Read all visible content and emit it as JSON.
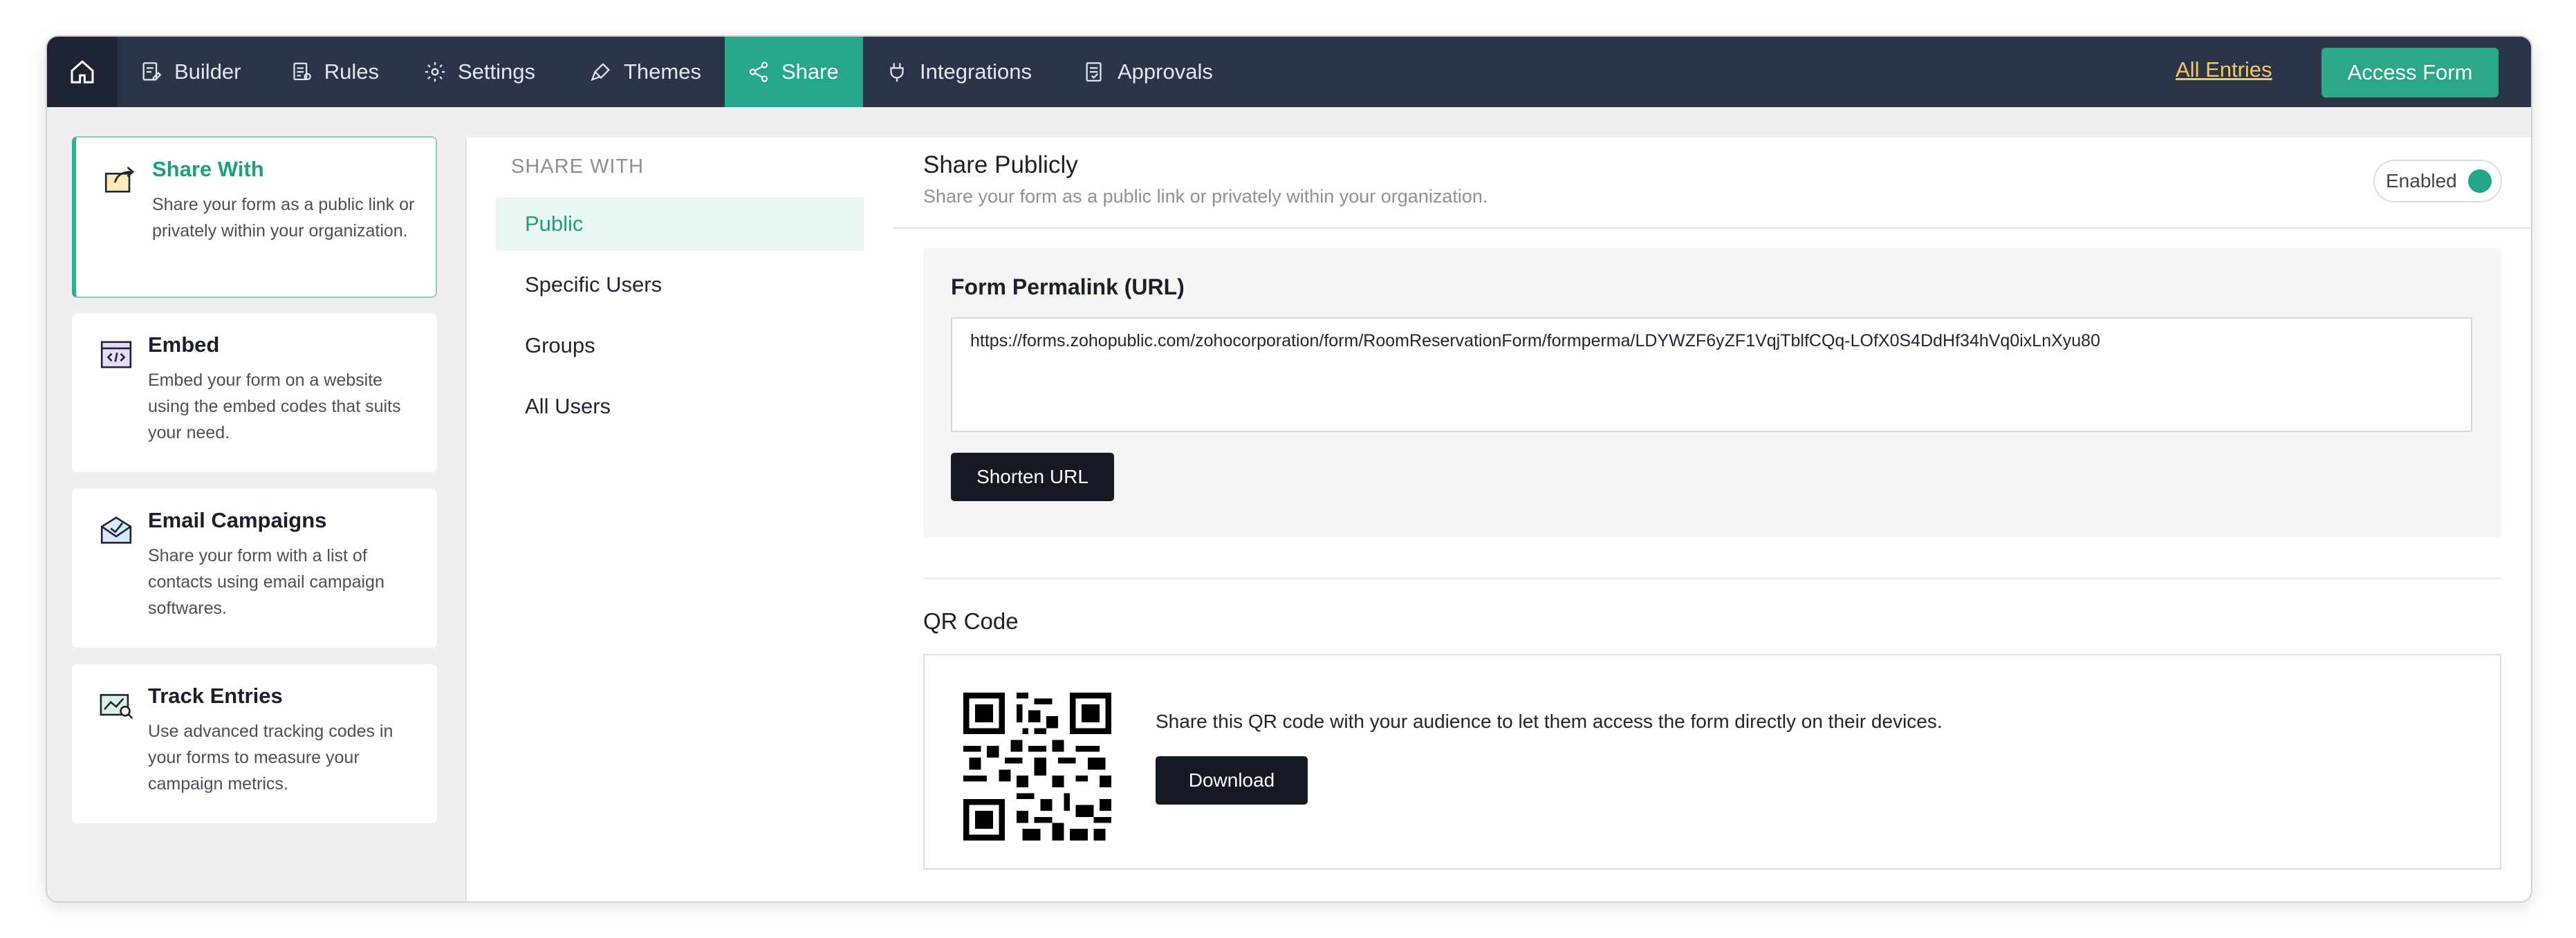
{
  "nav": {
    "items": [
      {
        "label": "Builder",
        "icon": "builder-icon"
      },
      {
        "label": "Rules",
        "icon": "rules-icon"
      },
      {
        "label": "Settings",
        "icon": "gear-icon"
      },
      {
        "label": "Themes",
        "icon": "brush-icon"
      },
      {
        "label": "Share",
        "icon": "share-icon",
        "active": true
      },
      {
        "label": "Integrations",
        "icon": "plug-icon"
      },
      {
        "label": "Approvals",
        "icon": "approvals-icon"
      }
    ],
    "all_entries": "All Entries",
    "access_form": "Access Form"
  },
  "share_types": [
    {
      "title": "Share With",
      "desc": "Share your form as a public link or privately within your organization.",
      "icon": "share-with-icon",
      "active": true
    },
    {
      "title": "Embed",
      "desc": "Embed your form on a website using the embed codes that suits your need.",
      "icon": "embed-code-icon"
    },
    {
      "title": "Email Campaigns",
      "desc": "Share your form with a list of contacts using email campaign softwares.",
      "icon": "email-campaign-icon"
    },
    {
      "title": "Track Entries",
      "desc": "Use advanced tracking codes in your forms to measure your campaign metrics.",
      "icon": "track-chart-icon"
    }
  ],
  "share_with": {
    "heading": "SHARE WITH",
    "options": [
      "Public",
      "Specific Users",
      "Groups",
      "All Users"
    ],
    "selected": "Public"
  },
  "share_publicly": {
    "title": "Share Publicly",
    "subtitle": "Share your form as a public link or privately within your organization.",
    "toggle_label": "Enabled",
    "enabled": true
  },
  "permalink": {
    "label": "Form Permalink (URL)",
    "url": "https://forms.zohopublic.com/zohocorporation/form/RoomReservationForm/formperma/LDYWZF6yZF1VqjTblfCQq-LOfX0S4DdHf34hVq0ixLnXyu80",
    "shorten_button": "Shorten URL"
  },
  "qr": {
    "title": "QR Code",
    "text": "Share this QR code with your audience to let them access the form directly on their devices.",
    "download_button": "Download"
  },
  "colors": {
    "nav_bg": "#2c3447",
    "accent": "#26a68a",
    "link": "#f2c86b"
  }
}
